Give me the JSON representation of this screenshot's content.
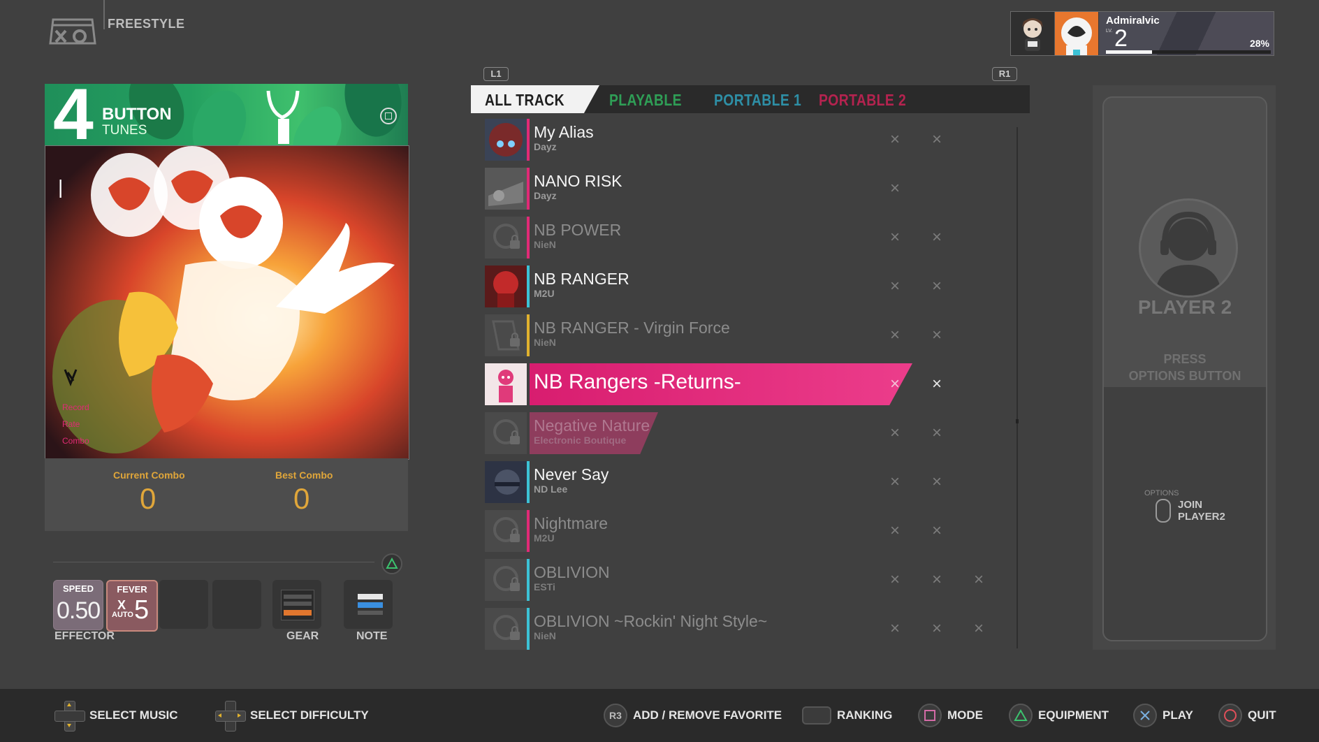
{
  "header": {
    "mode_label": "FREESTYLE",
    "profile": {
      "name": "Admiralvic",
      "level_label": "LV.",
      "level": "2",
      "xp_progress_percent": 28,
      "xp_label": "28%"
    }
  },
  "album": {
    "big_number": "4",
    "line1": "BUTTON",
    "line2": "TUNES",
    "current_combo_label": "Current Combo",
    "current_combo": "0",
    "best_combo_label": "Best Combo",
    "best_combo": "0",
    "art_labels": [
      "Record",
      "Rate",
      "Combo"
    ]
  },
  "effector": {
    "speed_title": "SPEED",
    "speed_value": "0.50",
    "fever_title": "FEVER",
    "fever_x": "X",
    "fever_auto": "AUTO",
    "fever_value": "5",
    "effector_label": "EFFECTOR",
    "gear_label": "GEAR",
    "note_label": "NOTE"
  },
  "tabs": {
    "l1": "L1",
    "r1": "R1",
    "items": [
      {
        "label": "ALL TRACK",
        "color": "#1e1e1e"
      },
      {
        "label": "PLAYABLE",
        "color": "#2f9e56"
      },
      {
        "label": "PORTABLE 1",
        "color": "#2e8fa6"
      },
      {
        "label": "PORTABLE 2",
        "color": "#b4234f"
      }
    ]
  },
  "tracks": [
    {
      "title": "My Alias",
      "artist": "Dayz",
      "locked": false,
      "stripe": "#e02a76",
      "diffs": [
        "×",
        "×"
      ]
    },
    {
      "title": "NANO RISK",
      "artist": "Dayz",
      "locked": false,
      "stripe": "#e02a76",
      "diffs": [
        "×"
      ]
    },
    {
      "title": "NB POWER",
      "artist": "NieN",
      "locked": true,
      "stripe": "#e02a76",
      "diffs": [
        "×",
        "×"
      ]
    },
    {
      "title": "NB RANGER",
      "artist": "M2U",
      "locked": false,
      "stripe": "#3cc2d6",
      "diffs": [
        "×",
        "×"
      ]
    },
    {
      "title": "NB RANGER - Virgin Force",
      "artist": "NieN",
      "locked": true,
      "stripe": "#e0b12e",
      "diffs": [
        "×",
        "×"
      ]
    },
    {
      "title": "NB Rangers -Returns-",
      "artist": "",
      "locked": false,
      "stripe": "#e02a76",
      "diffs": [
        "×",
        "×"
      ],
      "selected": true
    },
    {
      "title": "Negative Nature",
      "artist": "Electronic Boutique",
      "locked": true,
      "stripe": "#e02a76",
      "diffs": [
        "×",
        "×"
      ]
    },
    {
      "title": "Never Say",
      "artist": "ND Lee",
      "locked": false,
      "stripe": "#3cc2d6",
      "diffs": [
        "×",
        "×"
      ]
    },
    {
      "title": "Nightmare",
      "artist": "M2U",
      "locked": true,
      "stripe": "#e02a76",
      "diffs": [
        "×",
        "×"
      ]
    },
    {
      "title": "OBLIVION",
      "artist": "ESTi",
      "locked": true,
      "stripe": "#3cc2d6",
      "diffs": [
        "×",
        "×",
        "×"
      ]
    },
    {
      "title": "OBLIVION ~Rockin' Night Style~",
      "artist": "NieN",
      "locked": true,
      "stripe": "#3cc2d6",
      "diffs": [
        "×",
        "×",
        "×"
      ]
    }
  ],
  "player2": {
    "title": "PLAYER 2",
    "press_line1": "PRESS",
    "press_line2": "OPTIONS BUTTON",
    "options_small": "OPTIONS",
    "join_line1": "JOIN",
    "join_line2": "PLAYER2"
  },
  "hints": {
    "select_music": "SELECT MUSIC",
    "select_difficulty": "SELECT DIFFICULTY",
    "r3": "R3",
    "favorite": "ADD / REMOVE FAVORITE",
    "ranking": "RANKING",
    "mode": "MODE",
    "equipment": "EQUIPMENT",
    "play": "PLAY",
    "quit": "QUIT"
  },
  "icons": {
    "mode_logo": "controller-logo-icon",
    "square": "square-button-icon",
    "triangle": "triangle-button-icon",
    "cross": "cross-button-icon",
    "circle": "circle-button-icon",
    "lock": "lock-icon"
  }
}
